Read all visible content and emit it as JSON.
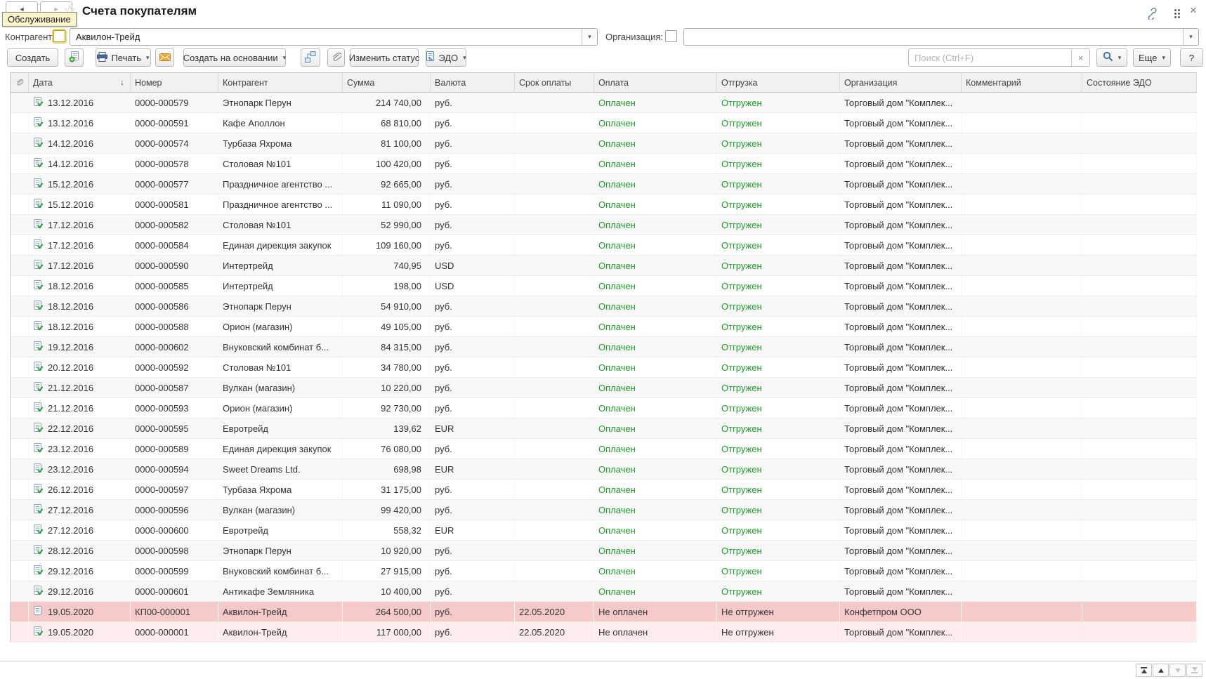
{
  "window": {
    "title": "Счета покупателям",
    "tooltip": "Обслуживание"
  },
  "icons": {
    "sort_desc": "↓",
    "dropdown": "▾",
    "back": "◄",
    "forward": "►",
    "star": "☆",
    "close": "×",
    "clear": "×"
  },
  "filters": {
    "kontragent_label": "Контрагент:",
    "kontragent_value": "Аквилон-Трейд",
    "organization_label": "Организация:",
    "organization_value": ""
  },
  "toolbar": {
    "create": "Создать",
    "print": "Печать",
    "create_based_on": "Создать на основании",
    "change_status": "Изменить статус",
    "edo": "ЭДО",
    "more": "Еще",
    "help": "?"
  },
  "search": {
    "placeholder": "Поиск (Ctrl+F)"
  },
  "colors": {
    "status_ok": "#1f9d2b",
    "overdue_strong": "#f7caca",
    "overdue_light": "#fcecec"
  },
  "table": {
    "headers": [
      "Дата",
      "Номер",
      "Контрагент",
      "Сумма",
      "Валюта",
      "Срок оплаты",
      "Оплата",
      "Отгрузка",
      "Организация",
      "Комментарий",
      "Состояние ЭДО"
    ],
    "rows": [
      {
        "date": "13.12.2016",
        "number": "0000-000579",
        "contractor": "Этнопарк Перун",
        "sum": "214 740,00",
        "currency": "руб.",
        "due": "",
        "payment": "Оплачен",
        "shipment": "Отгружен",
        "org": "Торговый дом \"Комплек...",
        "comment": "",
        "edo": "",
        "posted": true,
        "highlight": "none"
      },
      {
        "date": "13.12.2016",
        "number": "0000-000591",
        "contractor": "Кафе Аполлон",
        "sum": "68 810,00",
        "currency": "руб.",
        "due": "",
        "payment": "Оплачен",
        "shipment": "Отгружен",
        "org": "Торговый дом \"Комплек...",
        "comment": "",
        "edo": "",
        "posted": true,
        "highlight": "none"
      },
      {
        "date": "14.12.2016",
        "number": "0000-000574",
        "contractor": "Турбаза Яхрома",
        "sum": "81 100,00",
        "currency": "руб.",
        "due": "",
        "payment": "Оплачен",
        "shipment": "Отгружен",
        "org": "Торговый дом \"Комплек...",
        "comment": "",
        "edo": "",
        "posted": true,
        "highlight": "none"
      },
      {
        "date": "14.12.2016",
        "number": "0000-000578",
        "contractor": "Столовая №101",
        "sum": "100 420,00",
        "currency": "руб.",
        "due": "",
        "payment": "Оплачен",
        "shipment": "Отгружен",
        "org": "Торговый дом \"Комплек...",
        "comment": "",
        "edo": "",
        "posted": true,
        "highlight": "none"
      },
      {
        "date": "15.12.2016",
        "number": "0000-000577",
        "contractor": "Праздничное агентство ...",
        "sum": "92 665,00",
        "currency": "руб.",
        "due": "",
        "payment": "Оплачен",
        "shipment": "Отгружен",
        "org": "Торговый дом \"Комплек...",
        "comment": "",
        "edo": "",
        "posted": true,
        "highlight": "none"
      },
      {
        "date": "15.12.2016",
        "number": "0000-000581",
        "contractor": "Праздничное агентство ...",
        "sum": "11 090,00",
        "currency": "руб.",
        "due": "",
        "payment": "Оплачен",
        "shipment": "Отгружен",
        "org": "Торговый дом \"Комплек...",
        "comment": "",
        "edo": "",
        "posted": true,
        "highlight": "none"
      },
      {
        "date": "17.12.2016",
        "number": "0000-000582",
        "contractor": "Столовая №101",
        "sum": "52 990,00",
        "currency": "руб.",
        "due": "",
        "payment": "Оплачен",
        "shipment": "Отгружен",
        "org": "Торговый дом \"Комплек...",
        "comment": "",
        "edo": "",
        "posted": true,
        "highlight": "none"
      },
      {
        "date": "17.12.2016",
        "number": "0000-000584",
        "contractor": "Единая дирекция закупок",
        "sum": "109 160,00",
        "currency": "руб.",
        "due": "",
        "payment": "Оплачен",
        "shipment": "Отгружен",
        "org": "Торговый дом \"Комплек...",
        "comment": "",
        "edo": "",
        "posted": true,
        "highlight": "none"
      },
      {
        "date": "17.12.2016",
        "number": "0000-000590",
        "contractor": "Интертрейд",
        "sum": "740,95",
        "currency": "USD",
        "due": "",
        "payment": "Оплачен",
        "shipment": "Отгружен",
        "org": "Торговый дом \"Комплек...",
        "comment": "",
        "edo": "",
        "posted": true,
        "highlight": "none"
      },
      {
        "date": "18.12.2016",
        "number": "0000-000585",
        "contractor": "Интертрейд",
        "sum": "198,00",
        "currency": "USD",
        "due": "",
        "payment": "Оплачен",
        "shipment": "Отгружен",
        "org": "Торговый дом \"Комплек...",
        "comment": "",
        "edo": "",
        "posted": true,
        "highlight": "none"
      },
      {
        "date": "18.12.2016",
        "number": "0000-000586",
        "contractor": "Этнопарк Перун",
        "sum": "54 910,00",
        "currency": "руб.",
        "due": "",
        "payment": "Оплачен",
        "shipment": "Отгружен",
        "org": "Торговый дом \"Комплек...",
        "comment": "",
        "edo": "",
        "posted": true,
        "highlight": "none"
      },
      {
        "date": "18.12.2016",
        "number": "0000-000588",
        "contractor": "Орион (магазин)",
        "sum": "49 105,00",
        "currency": "руб.",
        "due": "",
        "payment": "Оплачен",
        "shipment": "Отгружен",
        "org": "Торговый дом \"Комплек...",
        "comment": "",
        "edo": "",
        "posted": true,
        "highlight": "none"
      },
      {
        "date": "19.12.2016",
        "number": "0000-000602",
        "contractor": "Внуковский комбинат б...",
        "sum": "84 315,00",
        "currency": "руб.",
        "due": "",
        "payment": "Оплачен",
        "shipment": "Отгружен",
        "org": "Торговый дом \"Комплек...",
        "comment": "",
        "edo": "",
        "posted": true,
        "highlight": "none"
      },
      {
        "date": "20.12.2016",
        "number": "0000-000592",
        "contractor": "Столовая №101",
        "sum": "34 780,00",
        "currency": "руб.",
        "due": "",
        "payment": "Оплачен",
        "shipment": "Отгружен",
        "org": "Торговый дом \"Комплек...",
        "comment": "",
        "edo": "",
        "posted": true,
        "highlight": "none"
      },
      {
        "date": "21.12.2016",
        "number": "0000-000587",
        "contractor": "Вулкан (магазин)",
        "sum": "10 220,00",
        "currency": "руб.",
        "due": "",
        "payment": "Оплачен",
        "shipment": "Отгружен",
        "org": "Торговый дом \"Комплек...",
        "comment": "",
        "edo": "",
        "posted": true,
        "highlight": "none"
      },
      {
        "date": "21.12.2016",
        "number": "0000-000593",
        "contractor": "Орион (магазин)",
        "sum": "92 730,00",
        "currency": "руб.",
        "due": "",
        "payment": "Оплачен",
        "shipment": "Отгружен",
        "org": "Торговый дом \"Комплек...",
        "comment": "",
        "edo": "",
        "posted": true,
        "highlight": "none"
      },
      {
        "date": "22.12.2016",
        "number": "0000-000595",
        "contractor": "Евротрейд",
        "sum": "139,62",
        "currency": "EUR",
        "due": "",
        "payment": "Оплачен",
        "shipment": "Отгружен",
        "org": "Торговый дом \"Комплек...",
        "comment": "",
        "edo": "",
        "posted": true,
        "highlight": "none"
      },
      {
        "date": "23.12.2016",
        "number": "0000-000589",
        "contractor": "Единая дирекция закупок",
        "sum": "76 080,00",
        "currency": "руб.",
        "due": "",
        "payment": "Оплачен",
        "shipment": "Отгружен",
        "org": "Торговый дом \"Комплек...",
        "comment": "",
        "edo": "",
        "posted": true,
        "highlight": "none"
      },
      {
        "date": "23.12.2016",
        "number": "0000-000594",
        "contractor": "Sweet Dreams Ltd.",
        "sum": "698,98",
        "currency": "EUR",
        "due": "",
        "payment": "Оплачен",
        "shipment": "Отгружен",
        "org": "Торговый дом \"Комплек...",
        "comment": "",
        "edo": "",
        "posted": true,
        "highlight": "none"
      },
      {
        "date": "26.12.2016",
        "number": "0000-000597",
        "contractor": "Турбаза Яхрома",
        "sum": "31 175,00",
        "currency": "руб.",
        "due": "",
        "payment": "Оплачен",
        "shipment": "Отгружен",
        "org": "Торговый дом \"Комплек...",
        "comment": "",
        "edo": "",
        "posted": true,
        "highlight": "none"
      },
      {
        "date": "27.12.2016",
        "number": "0000-000596",
        "contractor": "Вулкан (магазин)",
        "sum": "99 420,00",
        "currency": "руб.",
        "due": "",
        "payment": "Оплачен",
        "shipment": "Отгружен",
        "org": "Торговый дом \"Комплек...",
        "comment": "",
        "edo": "",
        "posted": true,
        "highlight": "none"
      },
      {
        "date": "27.12.2016",
        "number": "0000-000600",
        "contractor": "Евротрейд",
        "sum": "558,32",
        "currency": "EUR",
        "due": "",
        "payment": "Оплачен",
        "shipment": "Отгружен",
        "org": "Торговый дом \"Комплек...",
        "comment": "",
        "edo": "",
        "posted": true,
        "highlight": "none"
      },
      {
        "date": "28.12.2016",
        "number": "0000-000598",
        "contractor": "Этнопарк Перун",
        "sum": "10 920,00",
        "currency": "руб.",
        "due": "",
        "payment": "Оплачен",
        "shipment": "Отгружен",
        "org": "Торговый дом \"Комплек...",
        "comment": "",
        "edo": "",
        "posted": true,
        "highlight": "none"
      },
      {
        "date": "29.12.2016",
        "number": "0000-000599",
        "contractor": "Внуковский комбинат б...",
        "sum": "27 915,00",
        "currency": "руб.",
        "due": "",
        "payment": "Оплачен",
        "shipment": "Отгружен",
        "org": "Торговый дом \"Комплек...",
        "comment": "",
        "edo": "",
        "posted": true,
        "highlight": "none"
      },
      {
        "date": "29.12.2016",
        "number": "0000-000601",
        "contractor": "Антикафе Земляника",
        "sum": "10 400,00",
        "currency": "руб.",
        "due": "",
        "payment": "Оплачен",
        "shipment": "Отгружен",
        "org": "Торговый дом \"Комплек...",
        "comment": "",
        "edo": "",
        "posted": true,
        "highlight": "none"
      },
      {
        "date": "19.05.2020",
        "number": "КП00-000001",
        "contractor": "Аквилон-Трейд",
        "sum": "264 500,00",
        "currency": "руб.",
        "due": "22.05.2020",
        "payment": "Не оплачен",
        "shipment": "Не отгружен",
        "org": "Конфетпром ООО",
        "comment": "",
        "edo": "",
        "posted": false,
        "highlight": "strong"
      },
      {
        "date": "19.05.2020",
        "number": "0000-000001",
        "contractor": "Аквилон-Трейд",
        "sum": "117 000,00",
        "currency": "руб.",
        "due": "22.05.2020",
        "payment": "Не оплачен",
        "shipment": "Не отгружен",
        "org": "Торговый дом \"Комплек...",
        "comment": "",
        "edo": "",
        "posted": true,
        "highlight": "light"
      }
    ]
  }
}
